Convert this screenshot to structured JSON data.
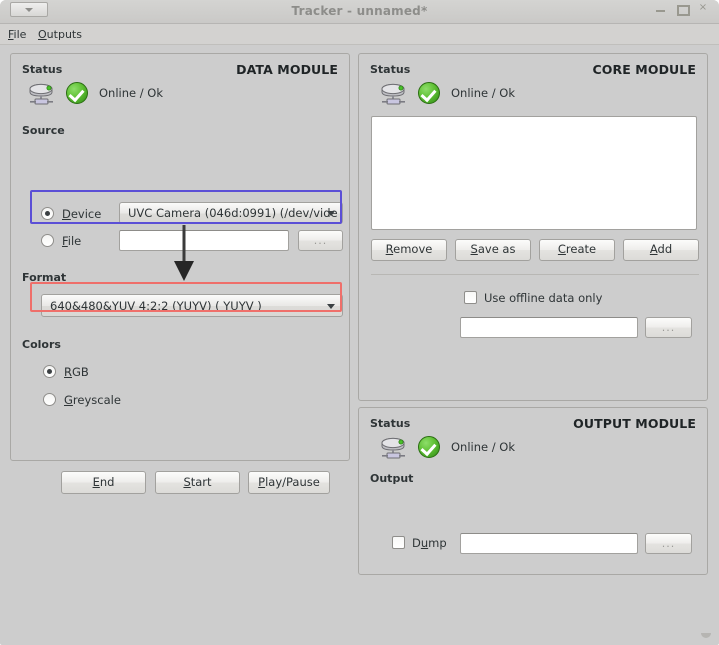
{
  "window": {
    "title": "Tracker - unnamed*",
    "menu_button_icon": "chevron-down-icon",
    "minimize_label": "",
    "maximize_label": "",
    "close_label": "×"
  },
  "menubar": {
    "items": [
      {
        "label": "File",
        "mnemonic": "F"
      },
      {
        "label": "Outputs",
        "mnemonic": "O"
      }
    ]
  },
  "data_module": {
    "title": "DATA MODULE",
    "status_label": "Status",
    "status_icon": "network-drive-icon",
    "status_ok_icon": "green-check-icon",
    "status_text": "Online / Ok",
    "source_label": "Source",
    "device_radio_label": "Device",
    "device_radio_mnemonic": "D",
    "device_radio_checked": true,
    "device_value": "UVC Camera (046d:0991) (/dev/vide",
    "file_radio_label": "File",
    "file_radio_mnemonic": "F",
    "file_radio_checked": false,
    "file_value": "",
    "file_browse_label": "...",
    "format_label": "Format",
    "format_value": "640&480&YUV 4:2:2 (YUYV) ( YUYV )",
    "colors_label": "Colors",
    "color_rgb_label": "RGB",
    "color_rgb_mnemonic": "R",
    "color_rgb_checked": true,
    "color_greyscale_label": "Greyscale",
    "color_greyscale_mnemonic": "G",
    "color_greyscale_checked": false
  },
  "core_module": {
    "title": "CORE MODULE",
    "status_label": "Status",
    "status_icon": "network-drive-icon",
    "status_ok_icon": "green-check-icon",
    "status_text": "Online / Ok",
    "list_items": [],
    "buttons": [
      {
        "label": "Remove",
        "mnemonic": "R"
      },
      {
        "label": "Save as",
        "mnemonic": "S"
      },
      {
        "label": "Create",
        "mnemonic": "C"
      },
      {
        "label": "Add",
        "mnemonic": "A"
      }
    ],
    "offline_checkbox_label": "Use offline data only",
    "offline_checked": false,
    "offline_path_value": "",
    "offline_browse_label": "..."
  },
  "output_module": {
    "title": "OUTPUT MODULE",
    "status_label": "Status",
    "status_icon": "network-drive-icon",
    "status_ok_icon": "green-check-icon",
    "status_text": "Online / Ok",
    "output_label": "Output",
    "dump_checkbox_label": "Dump",
    "dump_mnemonic": "u",
    "dump_checked": false,
    "dump_path_value": "",
    "dump_browse_label": "..."
  },
  "control_buttons": [
    {
      "label": "End",
      "mnemonic": "E"
    },
    {
      "label": "Start",
      "mnemonic": "S"
    },
    {
      "label": "Play/Pause",
      "mnemonic": "P"
    }
  ],
  "annotations": {
    "device_highlight_color": "#5b4fd6",
    "format_highlight_color": "#ef6f6a",
    "arrow_color": "#3b3b3b",
    "arrow_direction": "down"
  },
  "colors": {
    "window_bg": "#cdcdcd",
    "titlebar_bg": "#d0cfcd",
    "title_fg": "#8d8d8a",
    "text_fg": "#2e3436",
    "field_bg": "#ffffff",
    "status_ok_green": "#5fc034"
  }
}
